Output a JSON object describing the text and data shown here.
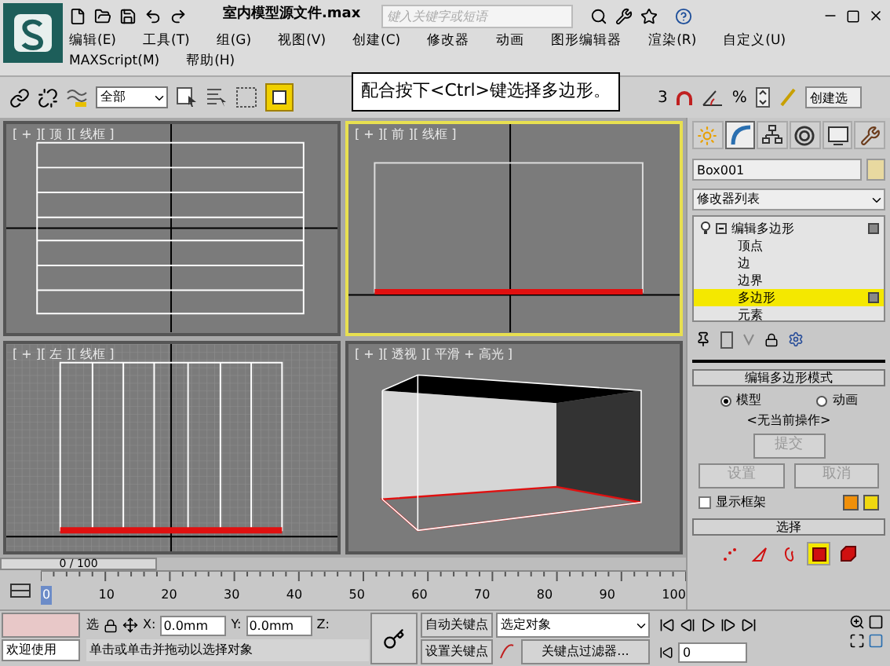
{
  "title_bar": {
    "title": "室内模型源文件.max",
    "search_placeholder": "键入关键字或短语"
  },
  "menu": [
    "编辑(E)",
    "工具(T)",
    "组(G)",
    "视图(V)",
    "创建(C)",
    "修改器",
    "动画",
    "图形编辑器",
    "渲染(R)",
    "自定义(U)",
    "MAXScript(M)",
    "帮助(H)"
  ],
  "toolbar": {
    "selection_filter": "全部",
    "tooltip": "配合按下<Ctrl>键选择多边形。",
    "snap_label": "3",
    "percent_label": "%",
    "named_selection": "创建选"
  },
  "viewports": [
    {
      "kind": "top",
      "label": "[ + ][ 顶 ][ 线框 ]",
      "selected": false
    },
    {
      "kind": "front",
      "label": "[ + ][ 前 ][ 线框 ]",
      "selected": true
    },
    {
      "kind": "left",
      "label": "[ + ][ 左 ][ 线框 ]",
      "selected": false
    },
    {
      "kind": "perspective",
      "label": "[ + ][ 透视 ][ 平滑 + 高光 ]",
      "selected": false
    }
  ],
  "command_panel": {
    "tabs": [
      {
        "kind": "create",
        "selected": false
      },
      {
        "kind": "modify",
        "selected": true
      },
      {
        "kind": "hierarchy",
        "selected": false
      },
      {
        "kind": "motion",
        "selected": false
      },
      {
        "kind": "display",
        "selected": false
      },
      {
        "kind": "utilities",
        "selected": false
      }
    ],
    "object_name": "Box001",
    "modifier_list": "修改器列表",
    "stack": [
      {
        "label": "编辑多边形",
        "expanded": true,
        "children": [
          {
            "label": "顶点",
            "selected": false
          },
          {
            "label": "边",
            "selected": false
          },
          {
            "label": "边界",
            "selected": false
          },
          {
            "label": "多边形",
            "selected": true
          },
          {
            "label": "元素",
            "selected": false
          }
        ]
      }
    ],
    "rollout": {
      "title": "编辑多边形模式",
      "modes": [
        {
          "label": "模型",
          "selected": true
        },
        {
          "label": "动画",
          "selected": false
        }
      ],
      "status": "<无当前操作>",
      "commit": {
        "label": "提交",
        "disabled": true
      },
      "buttons": [
        {
          "label": "设置",
          "disabled": true
        },
        {
          "label": "取消",
          "disabled": true
        }
      ],
      "show_cage": {
        "label": "显示框架",
        "checked": false
      }
    },
    "selection_rollout": {
      "title": "选择",
      "levels": [
        {
          "kind": "vertex",
          "selected": false
        },
        {
          "kind": "edge",
          "selected": false
        },
        {
          "kind": "border",
          "selected": false
        },
        {
          "kind": "polygon",
          "selected": true
        },
        {
          "kind": "element",
          "selected": false
        }
      ]
    }
  },
  "timeline": {
    "slider": {
      "label": "0 / 100",
      "level": 0
    },
    "ticks": [
      "0",
      "10",
      "20",
      "30",
      "40",
      "50",
      "60",
      "70",
      "80",
      "90",
      "100"
    ]
  },
  "status_bar": {
    "welcome": "欢迎使用",
    "selected_label": "选",
    "x_label": "X:",
    "x": "0.0mm",
    "y_label": "Y:",
    "y": "0.0mm",
    "z_label": "Z:",
    "prompt": "单击或单击并拖动以选择对象",
    "auto_key": "自动关键点",
    "set_key": "设置关键点",
    "key_mode": "选定对象",
    "key_filters": "关键点过滤器...",
    "frame": "0"
  }
}
